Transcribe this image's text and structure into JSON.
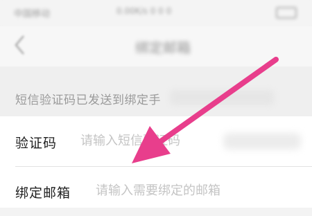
{
  "status_bar": {
    "carrier": "中国移动",
    "center_info": "0.00K/s 0 0 0",
    "battery": ""
  },
  "nav": {
    "title": "绑定邮箱",
    "back_icon": "chevron-left-icon"
  },
  "notice": {
    "text": "短信验证码已发送到绑定手"
  },
  "form": {
    "code_row": {
      "label": "验证码",
      "placeholder": "请输入短信验证码"
    },
    "email_row": {
      "label": "绑定邮箱",
      "placeholder": "请输入需要绑定的邮箱"
    }
  },
  "annotation": {
    "color": "#e83e8c",
    "icon": "pointer-arrow-icon"
  }
}
